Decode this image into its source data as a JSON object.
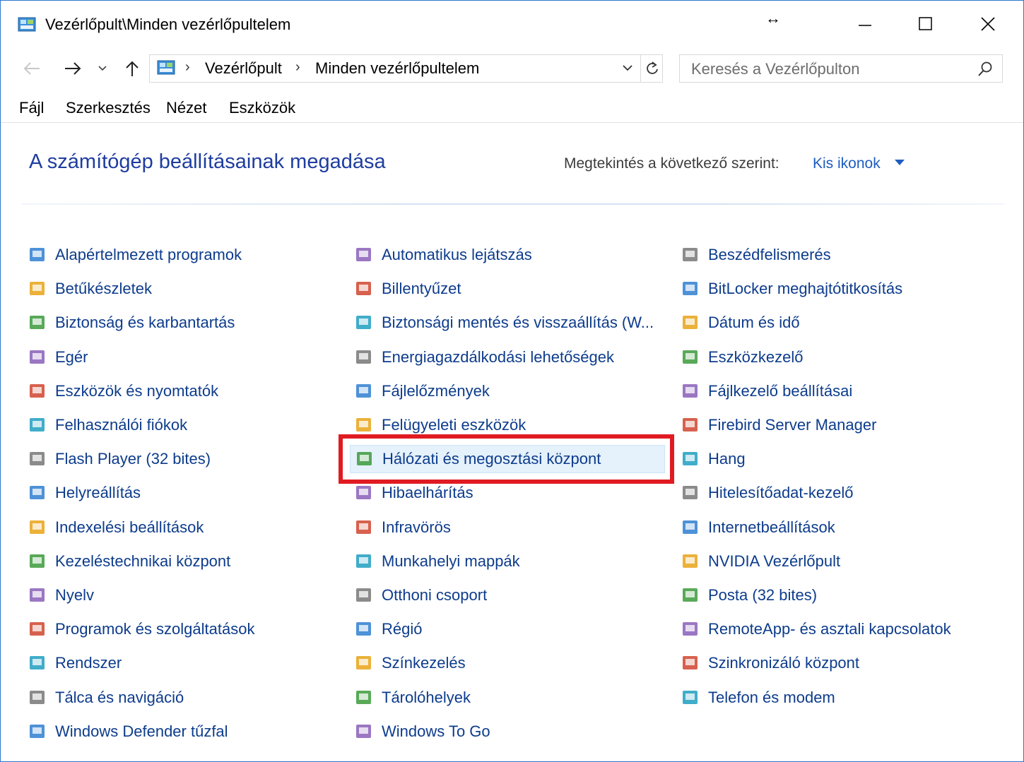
{
  "window": {
    "title": "Vezérlőpult\\Minden vezérlőpultelem",
    "buttons": {
      "resize": "↔",
      "minimize": "—",
      "maximize": "☐",
      "close": "✕"
    }
  },
  "address": {
    "breadcrumbs": [
      "Vezérlőpult",
      "Minden vezérlőpultelem"
    ],
    "search_placeholder": "Keresés a Vezérlőpulton"
  },
  "menu": [
    "Fájl",
    "Szerkesztés",
    "Nézet",
    "Eszközök"
  ],
  "header": {
    "title": "A számítógép beállításainak megadása",
    "view_label": "Megtekintés a következő szerint:",
    "view_value": "Kis ikonok"
  },
  "items": {
    "col1": [
      {
        "label": "Alapértelmezett programok",
        "icon": "default-programs-icon"
      },
      {
        "label": "Betűkészletek",
        "icon": "fonts-icon"
      },
      {
        "label": "Biztonság és karbantartás",
        "icon": "flag-icon"
      },
      {
        "label": "Egér",
        "icon": "mouse-icon"
      },
      {
        "label": "Eszközök és nyomtatók",
        "icon": "printer-icon"
      },
      {
        "label": "Felhasználói fiókok",
        "icon": "users-icon"
      },
      {
        "label": "Flash Player (32 bites)",
        "icon": "flash-icon"
      },
      {
        "label": "Helyreállítás",
        "icon": "recovery-icon"
      },
      {
        "label": "Indexelési beállítások",
        "icon": "indexing-icon"
      },
      {
        "label": "Kezeléstechnikai központ",
        "icon": "ease-of-access-icon"
      },
      {
        "label": "Nyelv",
        "icon": "language-icon"
      },
      {
        "label": "Programok és szolgáltatások",
        "icon": "programs-icon"
      },
      {
        "label": "Rendszer",
        "icon": "system-icon"
      },
      {
        "label": "Tálca és navigáció",
        "icon": "taskbar-icon"
      },
      {
        "label": "Windows Defender tűzfal",
        "icon": "firewall-icon"
      }
    ],
    "col2": [
      {
        "label": "Automatikus lejátszás",
        "icon": "autoplay-icon"
      },
      {
        "label": "Billentyűzet",
        "icon": "keyboard-icon"
      },
      {
        "label": "Biztonsági mentés és visszaállítás (W...",
        "icon": "backup-icon"
      },
      {
        "label": "Energiagazdálkodási lehetőségek",
        "icon": "power-icon"
      },
      {
        "label": "Fájlelőzmények",
        "icon": "file-history-icon"
      },
      {
        "label": "Felügyeleti eszközök",
        "icon": "admin-tools-icon"
      },
      {
        "label": "Hálózati és megosztási központ",
        "icon": "network-icon"
      },
      {
        "label": "Hibaelhárítás",
        "icon": "troubleshooting-icon"
      },
      {
        "label": "Infravörös",
        "icon": "infrared-icon"
      },
      {
        "label": "Munkahelyi mappák",
        "icon": "work-folders-icon"
      },
      {
        "label": "Otthoni csoport",
        "icon": "homegroup-icon"
      },
      {
        "label": "Régió",
        "icon": "region-icon"
      },
      {
        "label": "Színkezelés",
        "icon": "color-management-icon"
      },
      {
        "label": "Tárolóhelyek",
        "icon": "storage-spaces-icon"
      },
      {
        "label": "Windows To Go",
        "icon": "windows-to-go-icon"
      }
    ],
    "col3": [
      {
        "label": "Beszédfelismerés",
        "icon": "microphone-icon"
      },
      {
        "label": "BitLocker meghajtótitkosítás",
        "icon": "bitlocker-icon"
      },
      {
        "label": "Dátum és idő",
        "icon": "clock-icon"
      },
      {
        "label": "Eszközkezelő",
        "icon": "device-manager-icon"
      },
      {
        "label": "Fájlkezelő beállításai",
        "icon": "folder-options-icon"
      },
      {
        "label": "Firebird Server Manager",
        "icon": "firebird-icon"
      },
      {
        "label": "Hang",
        "icon": "speaker-icon"
      },
      {
        "label": "Hitelesítőadat-kezelő",
        "icon": "credential-manager-icon"
      },
      {
        "label": "Internetbeállítások",
        "icon": "internet-options-icon"
      },
      {
        "label": "NVIDIA Vezérlőpult",
        "icon": "nvidia-icon"
      },
      {
        "label": "Posta (32 bites)",
        "icon": "mail-icon"
      },
      {
        "label": "RemoteApp- és asztali kapcsolatok",
        "icon": "remoteapp-icon"
      },
      {
        "label": "Szinkronizáló központ",
        "icon": "sync-center-icon"
      },
      {
        "label": "Telefon és modem",
        "icon": "phone-modem-icon"
      }
    ]
  },
  "highlighted_item": "Hálózati és megosztási központ",
  "colors": {
    "link": "#0d3c8c",
    "title": "#1e3d9f",
    "highlight_bg": "#e5f1fb",
    "annotation": "#e11b22"
  }
}
